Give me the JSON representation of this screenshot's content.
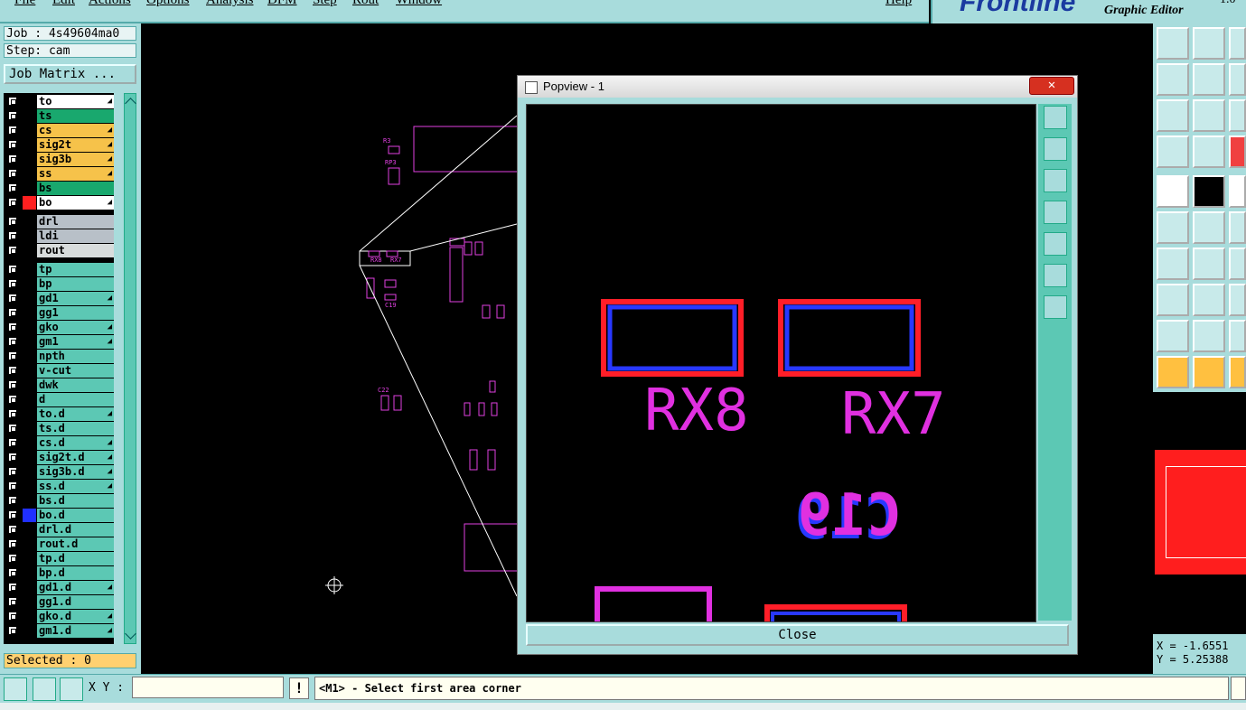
{
  "menubar": {
    "items": [
      "File",
      "Edit",
      "Actions",
      "Options",
      "Analysis",
      "DFM",
      "Step",
      "Rout",
      "Window"
    ],
    "help": "Help"
  },
  "logo": {
    "brand": "Frontline",
    "subtitle": "Graphic Editor",
    "version": "1.0"
  },
  "job": {
    "job_label": "Job : 4s49604ma0",
    "step_label": "Step: cam",
    "matrix_button": "Job Matrix ..."
  },
  "layers": [
    {
      "name": "to",
      "color": "#ffffff",
      "mark": true,
      "swatch": "#000000"
    },
    {
      "name": "ts",
      "color": "#19a86e",
      "mark": false,
      "swatch": "#000000"
    },
    {
      "name": "cs",
      "color": "#f6c24a",
      "mark": true,
      "swatch": "#000000"
    },
    {
      "name": "sig2t",
      "color": "#f6c24a",
      "mark": true,
      "swatch": "#000000"
    },
    {
      "name": "sig3b",
      "color": "#f6c24a",
      "mark": true,
      "swatch": "#000000"
    },
    {
      "name": "ss",
      "color": "#f6c24a",
      "mark": true,
      "swatch": "#000000"
    },
    {
      "name": "bs",
      "color": "#19a86e",
      "mark": false,
      "swatch": "#000000"
    },
    {
      "name": "bo",
      "color": "#ffffff",
      "mark": true,
      "swatch": "#ff2020"
    },
    {
      "name": "drl",
      "color": "#b8c0c8",
      "mark": false,
      "swatch": "#000000"
    },
    {
      "name": "ldi",
      "color": "#b8c0c8",
      "mark": false,
      "swatch": "#000000"
    },
    {
      "name": "rout",
      "color": "#d8dcdc",
      "mark": false,
      "swatch": "#000000"
    },
    {
      "name": "tp",
      "color": "#5cc8b4",
      "mark": false,
      "swatch": "#000000"
    },
    {
      "name": "bp",
      "color": "#5cc8b4",
      "mark": false,
      "swatch": "#000000"
    },
    {
      "name": "gd1",
      "color": "#5cc8b4",
      "mark": true,
      "swatch": "#000000"
    },
    {
      "name": "gg1",
      "color": "#5cc8b4",
      "mark": false,
      "swatch": "#000000"
    },
    {
      "name": "gko",
      "color": "#5cc8b4",
      "mark": true,
      "swatch": "#000000"
    },
    {
      "name": "gm1",
      "color": "#5cc8b4",
      "mark": true,
      "swatch": "#000000"
    },
    {
      "name": "npth",
      "color": "#5cc8b4",
      "mark": false,
      "swatch": "#000000"
    },
    {
      "name": "v-cut",
      "color": "#5cc8b4",
      "mark": false,
      "swatch": "#000000"
    },
    {
      "name": "dwk",
      "color": "#5cc8b4",
      "mark": false,
      "swatch": "#000000"
    },
    {
      "name": "d",
      "color": "#5cc8b4",
      "mark": false,
      "swatch": "#000000"
    },
    {
      "name": "to.d",
      "color": "#5cc8b4",
      "mark": true,
      "swatch": "#000000"
    },
    {
      "name": "ts.d",
      "color": "#5cc8b4",
      "mark": false,
      "swatch": "#000000"
    },
    {
      "name": "cs.d",
      "color": "#5cc8b4",
      "mark": true,
      "swatch": "#000000"
    },
    {
      "name": "sig2t.d",
      "color": "#5cc8b4",
      "mark": true,
      "swatch": "#000000"
    },
    {
      "name": "sig3b.d",
      "color": "#5cc8b4",
      "mark": true,
      "swatch": "#000000"
    },
    {
      "name": "ss.d",
      "color": "#5cc8b4",
      "mark": true,
      "swatch": "#000000"
    },
    {
      "name": "bs.d",
      "color": "#5cc8b4",
      "mark": false,
      "swatch": "#000000"
    },
    {
      "name": "bo.d",
      "color": "#5cc8b4",
      "mark": false,
      "swatch": "#2030ff"
    },
    {
      "name": "drl.d",
      "color": "#5cc8b4",
      "mark": false,
      "swatch": "#000000"
    },
    {
      "name": "rout.d",
      "color": "#5cc8b4",
      "mark": false,
      "swatch": "#000000"
    },
    {
      "name": "tp.d",
      "color": "#5cc8b4",
      "mark": false,
      "swatch": "#000000"
    },
    {
      "name": "bp.d",
      "color": "#5cc8b4",
      "mark": false,
      "swatch": "#000000"
    },
    {
      "name": "gd1.d",
      "color": "#5cc8b4",
      "mark": true,
      "swatch": "#000000"
    },
    {
      "name": "gg1.d",
      "color": "#5cc8b4",
      "mark": false,
      "swatch": "#000000"
    },
    {
      "name": "gko.d",
      "color": "#5cc8b4",
      "mark": true,
      "swatch": "#000000"
    },
    {
      "name": "gm1.d",
      "color": "#5cc8b4",
      "mark": true,
      "swatch": "#000000"
    }
  ],
  "selected": "Selected : 0",
  "popview": {
    "title": "Popview - 1",
    "close_label": "Close",
    "labels": {
      "rx8": "RX8",
      "rx7": "RX7",
      "c19": "C19"
    }
  },
  "canvas_labels": [
    "RX8",
    "RX7",
    "C19",
    "C22",
    "R3",
    "RP3"
  ],
  "coords": {
    "x": "X = -1.6551",
    "y": "Y = 5.25388"
  },
  "bottom": {
    "xy_label": "X Y :",
    "xy_value": "",
    "excl": "!",
    "status": "<M1> - Select first area corner"
  },
  "colors": {
    "accent": "#a8dcdc",
    "teal": "#5cc8b4",
    "magenta": "#e030e0",
    "red": "#ff1e28",
    "blue": "#2838ff"
  }
}
